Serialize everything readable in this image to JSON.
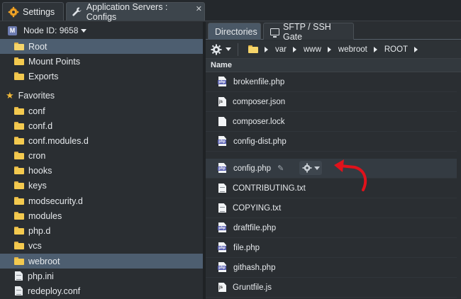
{
  "top_tabs": [
    {
      "label": "Settings",
      "icon": "gear-icon"
    },
    {
      "label": "Application Servers : Configs",
      "icon": "wrench-icon",
      "close": "✕"
    }
  ],
  "left": {
    "node_label": "Node ID: 9658",
    "node_badge": "M",
    "roots": [
      {
        "label": "Root"
      },
      {
        "label": "Mount Points"
      },
      {
        "label": "Exports"
      }
    ],
    "favorites_label": "Favorites",
    "favorites": [
      {
        "label": "conf",
        "type": "folder"
      },
      {
        "label": "conf.d",
        "type": "folder"
      },
      {
        "label": "conf.modules.d",
        "type": "folder"
      },
      {
        "label": "cron",
        "type": "folder"
      },
      {
        "label": "hooks",
        "type": "folder"
      },
      {
        "label": "keys",
        "type": "folder"
      },
      {
        "label": "modsecurity.d",
        "type": "folder"
      },
      {
        "label": "modules",
        "type": "folder"
      },
      {
        "label": "php.d",
        "type": "folder"
      },
      {
        "label": "vcs",
        "type": "folder"
      },
      {
        "label": "webroot",
        "type": "folder"
      },
      {
        "label": "php.ini",
        "type": "file"
      },
      {
        "label": "redeploy.conf",
        "type": "file"
      }
    ]
  },
  "right": {
    "tabs": [
      {
        "label": "Directories"
      },
      {
        "label": "SFTP / SSH Gate"
      }
    ],
    "path": [
      "var",
      "www",
      "webroot",
      "ROOT"
    ],
    "column_header": "Name",
    "files": [
      {
        "name": "brokenfile.php",
        "type": "php"
      },
      {
        "name": "composer.json",
        "type": "js"
      },
      {
        "name": "composer.lock",
        "type": "plain"
      },
      {
        "name": "config-dist.php",
        "type": "php"
      },
      {
        "name": "config.php",
        "type": "php"
      },
      {
        "name": "CONTRIBUTING.txt",
        "type": "txt"
      },
      {
        "name": "COPYING.txt",
        "type": "txt"
      },
      {
        "name": "draftfile.php",
        "type": "php"
      },
      {
        "name": "file.php",
        "type": "php"
      },
      {
        "name": "githash.php",
        "type": "php"
      },
      {
        "name": "Gruntfile.js",
        "type": "js"
      }
    ],
    "highlighted_file": "config.php"
  },
  "colors": {
    "selected_row": "#4d5e70",
    "folder": "#f3c94f",
    "annotation_arrow": "#e0121b"
  }
}
